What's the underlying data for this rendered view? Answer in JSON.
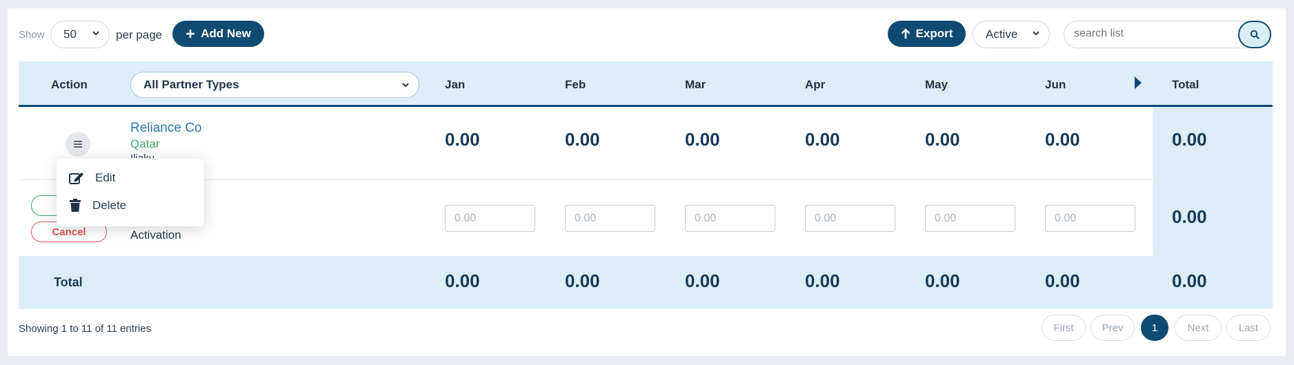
{
  "toolbar": {
    "show_label": "Show",
    "per_page_value": "50",
    "per_page_label": "per page",
    "add_label": "Add New",
    "export_label": "Export",
    "status_value": "Active",
    "search_placeholder": "search list"
  },
  "table": {
    "action_header": "Action",
    "partner_filter": "All Partner Types",
    "months": [
      "Jan",
      "Feb",
      "Mar",
      "Apr",
      "May",
      "Jun"
    ],
    "total_header": "Total",
    "row1": {
      "name": "Reliance Co",
      "country": "Qatar",
      "extra": "Iliaku",
      "values": [
        "0.00",
        "0.00",
        "0.00",
        "0.00",
        "0.00",
        "0.00"
      ],
      "total": "0.00"
    },
    "row2": {
      "cancel_label": "Cancel",
      "label": "Activation",
      "placeholders": [
        "0.00",
        "0.00",
        "0.00",
        "0.00",
        "0.00",
        "0.00"
      ],
      "total": "0.00"
    },
    "footer": {
      "label": "Total",
      "values": [
        "0.00",
        "0.00",
        "0.00",
        "0.00",
        "0.00",
        "0.00"
      ],
      "total": "0.00"
    }
  },
  "action_menu": {
    "edit_label": "Edit",
    "delete_label": "Delete"
  },
  "pagination": {
    "summary": "Showing 1 to 11 of 11 entries",
    "first": "First",
    "prev": "Prev",
    "current": "1",
    "next": "Next",
    "last": "Last"
  },
  "colors": {
    "primary": "#0f4a72",
    "header_bg": "#dcedf5",
    "link": "#2a7aa8",
    "success": "#3aa76d",
    "danger": "#d9534f"
  }
}
